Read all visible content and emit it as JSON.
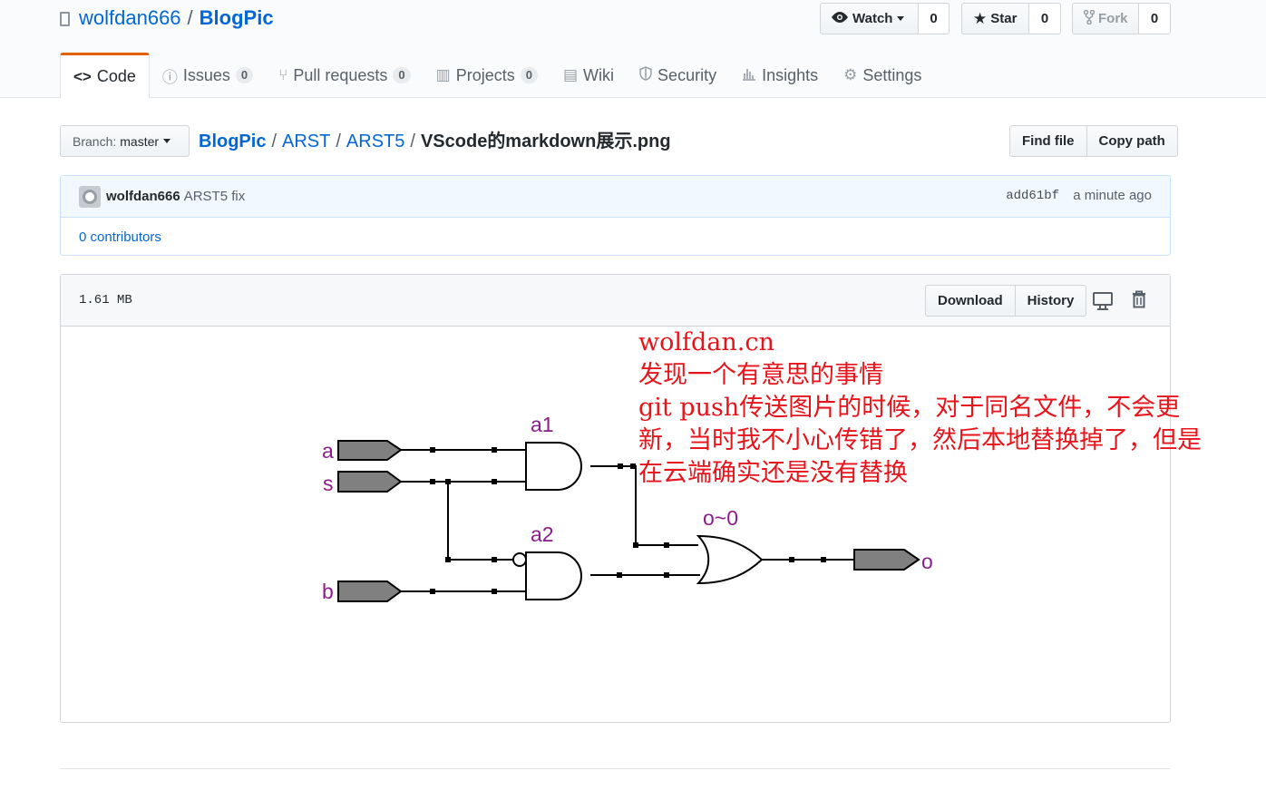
{
  "repo": {
    "owner": "wolfdan666",
    "separator": "/",
    "name": "BlogPic"
  },
  "header_buttons": {
    "watch": {
      "label": "Watch",
      "count": "0"
    },
    "star": {
      "label": "Star",
      "count": "0"
    },
    "fork": {
      "label": "Fork",
      "count": "0"
    }
  },
  "tabs": [
    {
      "label": "Code",
      "count": ""
    },
    {
      "label": "Issues",
      "count": "0"
    },
    {
      "label": "Pull requests",
      "count": "0"
    },
    {
      "label": "Projects",
      "count": "0"
    },
    {
      "label": "Wiki",
      "count": ""
    },
    {
      "label": "Security",
      "count": ""
    },
    {
      "label": "Insights",
      "count": ""
    },
    {
      "label": "Settings",
      "count": ""
    }
  ],
  "branch": {
    "label": "Branch:",
    "value": "master"
  },
  "breadcrumb": {
    "root": "BlogPic",
    "dir1": "ARST",
    "dir2": "ARST5",
    "file": "VScode的markdown展示.png",
    "sep": "/"
  },
  "file_nav": {
    "find_file": "Find file",
    "copy_path": "Copy path"
  },
  "commit": {
    "author": "wolfdan666",
    "message": "ARST5 fix",
    "sha": "add61bf",
    "time": "a minute ago",
    "contributors": "0 contributors"
  },
  "file": {
    "size": "1.61 MB",
    "download": "Download",
    "history": "History"
  },
  "circuit": {
    "inputs": {
      "a": "a",
      "s": "s",
      "b": "b"
    },
    "gates": {
      "and1": "a1",
      "and2": "a2",
      "or": "o~0"
    },
    "output": "o"
  },
  "note": {
    "line1": "wolfdan.cn",
    "line2": "发现一个有意思的事情",
    "line3": "git push传送图片的时候，对于同名文件，不会更",
    "line4": "新，当时我不小心传错了，然后本地替换掉了，但是",
    "line5": "在云端确实还是没有替换"
  },
  "colors": {
    "link": "#0366d6",
    "tab_accent": "#e36209",
    "note_red": "#e8141b",
    "label_purple": "#8b1c8b",
    "pin_gray": "#808080"
  }
}
